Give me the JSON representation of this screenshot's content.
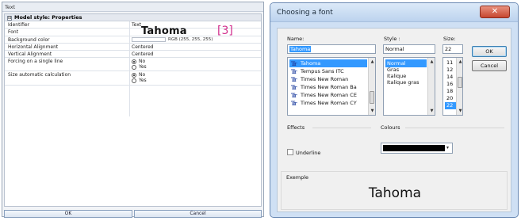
{
  "left": {
    "title": "Text",
    "section": {
      "collapse_glyph": "⊟",
      "title": "Model style: Properties"
    },
    "props": [
      {
        "name": "Identifier",
        "value": "Text"
      },
      {
        "name": "Font",
        "value": "Tahoma"
      },
      {
        "name": "Background color",
        "value": "RGB (255, 255, 255)"
      },
      {
        "name": "Horizontal Alignment",
        "value": "Centered"
      },
      {
        "name": "Vertical Alignment",
        "value": "Centered"
      },
      {
        "name": "Forcing on a single line",
        "options": [
          "No",
          "Yes"
        ],
        "selected": "No"
      },
      {
        "name": "Size automatic calculation",
        "options": [
          "No",
          "Yes"
        ],
        "selected": "No"
      }
    ],
    "callout": "[3]",
    "buttons": {
      "ok": "OK",
      "cancel": "Cancel"
    }
  },
  "dialog": {
    "title": "Choosing a font",
    "close_glyph": "✕",
    "name_label": "Name:",
    "name_value": "Tahoma",
    "style_label": "Style :",
    "style_value": "Normal",
    "size_label": "Size:",
    "size_value": "22",
    "fonts": [
      "Tahoma",
      "Tempus Sans ITC",
      "Times New Roman",
      "Times New Roman Ba",
      "Times New Roman CE",
      "Times New Roman CY"
    ],
    "selected_font": "Tahoma",
    "tt_glyph": "Tr",
    "styles": [
      "Normal",
      "Gras",
      "Italique",
      "Italique gras"
    ],
    "selected_style": "Normal",
    "sizes": [
      "11",
      "12",
      "14",
      "16",
      "18",
      "20",
      "22"
    ],
    "selected_size": "22",
    "ok": "OK",
    "cancel": "Cancel",
    "effects_label": "Effects",
    "underline_label": "Underline",
    "underline_checked": false,
    "colours_label": "Colours",
    "colour_value": "#000000",
    "sample_label": "Exemple",
    "sample_text": "Tahoma"
  }
}
